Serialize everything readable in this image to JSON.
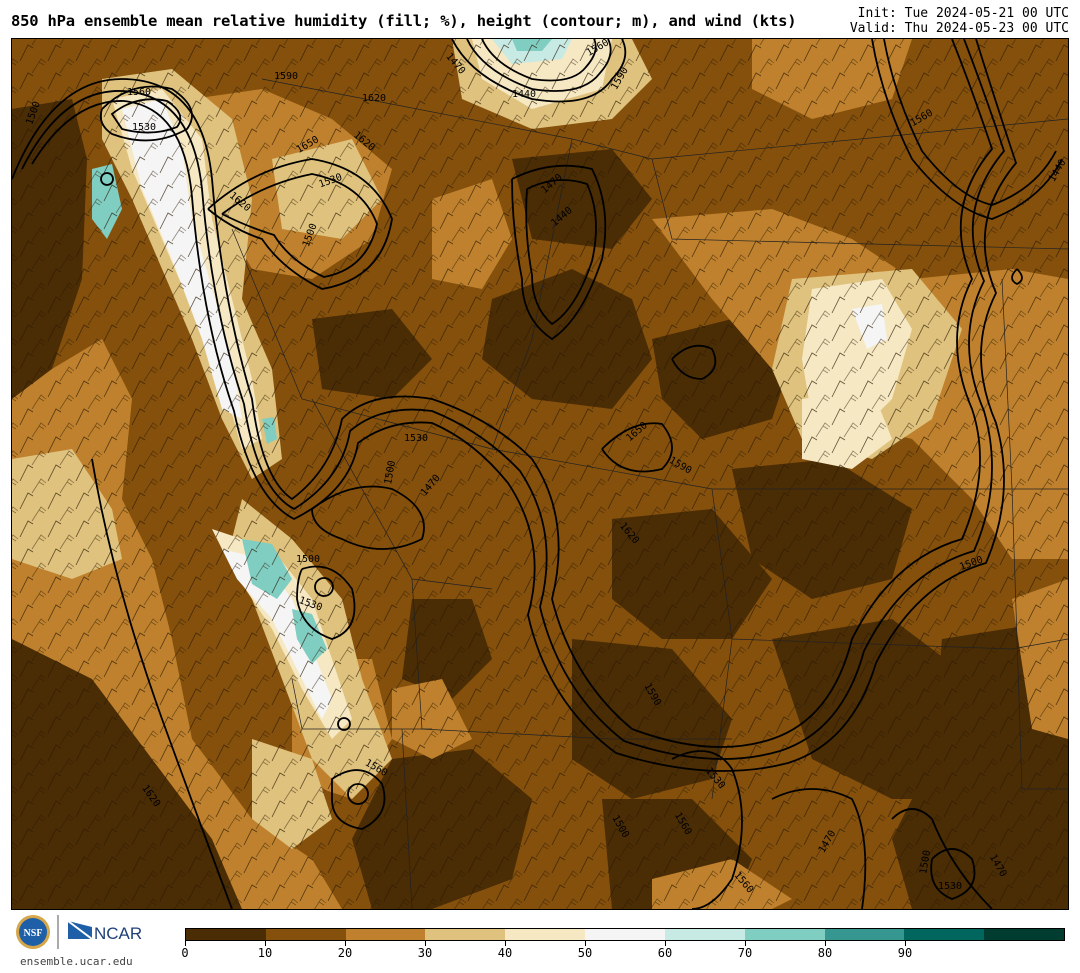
{
  "header": {
    "title": "850 hPa ensemble mean relative humidity (fill; %), height (contour; m), and wind (kts)",
    "init": "Init: Tue 2024-05-21 00 UTC",
    "valid": "Valid: Thu 2024-05-23 00 UTC"
  },
  "footer": {
    "url": "ensemble.ucar.edu",
    "nsf_logo_text": "NSF",
    "ncar_logo_text": "NCAR"
  },
  "colorbar": {
    "colors": [
      "#4a2c05",
      "#84500c",
      "#bf812d",
      "#dfc27d",
      "#f6e8c3",
      "#f5f5f5",
      "#c7eae5",
      "#80cdc1",
      "#35978f",
      "#01665e",
      "#003c30"
    ],
    "tick_labels": [
      "0",
      "10",
      "20",
      "30",
      "40",
      "50",
      "60",
      "70",
      "80",
      "90"
    ]
  },
  "contour_labels": [
    "1560",
    "1530",
    "1500",
    "1470",
    "1440",
    "1620",
    "1590",
    "1650",
    "1530",
    "1500",
    "1470",
    "1440",
    "1560",
    "1590",
    "1620",
    "1620",
    "1620",
    "1590",
    "1650",
    "1470",
    "1500",
    "1500",
    "1530",
    "1530",
    "1560",
    "1560",
    "1530",
    "1500",
    "1470",
    "1440",
    "1500",
    "1530",
    "1500",
    "1470",
    "1560",
    "1560",
    "1590",
    "1620"
  ]
}
